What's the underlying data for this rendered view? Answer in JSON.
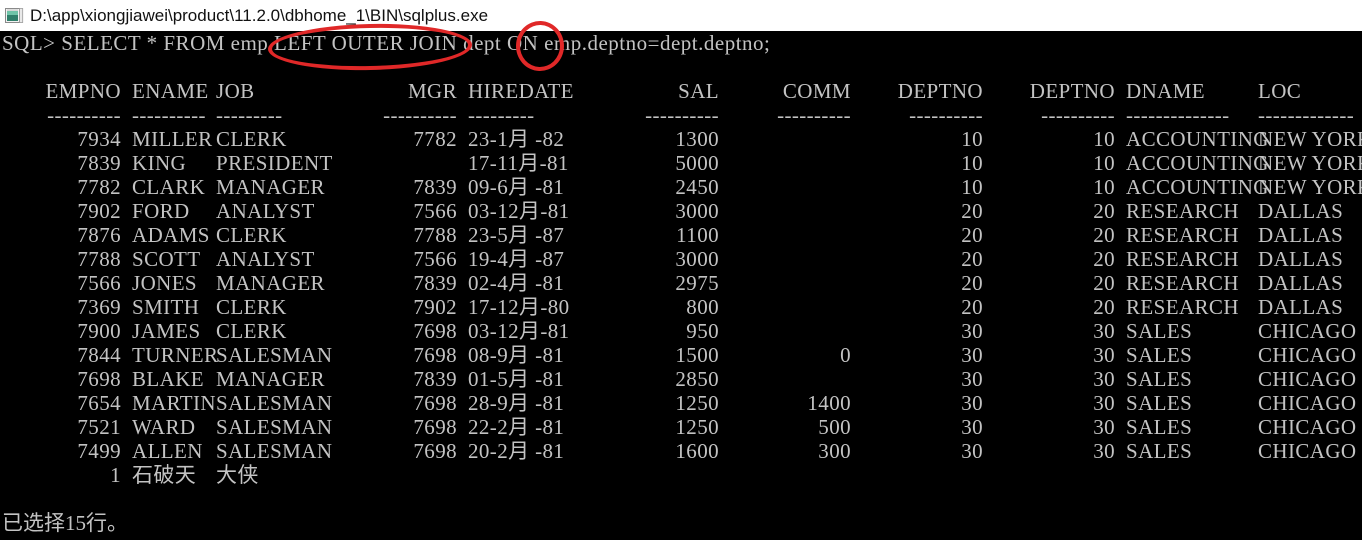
{
  "window": {
    "icon": "console-window-icon",
    "title": "D:\\app\\xiongjiawei\\product\\11.2.0\\dbhome_1\\BIN\\sqlplus.exe"
  },
  "console": {
    "prompt_line": "SQL> SELECT * FROM emp LEFT OUTER JOIN dept ON emp.deptno=dept.deptno;",
    "prompt": "SQL>",
    "statement": "SELECT * FROM emp LEFT OUTER JOIN dept ON emp.deptno=dept.deptno;",
    "status_line": "已选择15行。",
    "foreground_color": "#c3c3c3",
    "background_color": "#000000"
  },
  "annotations": [
    {
      "id": "ellipse-join",
      "target_text": "LEFT OUTER JOIN",
      "shape": "ellipse",
      "color": "#e02828"
    },
    {
      "id": "ellipse-on",
      "target_text": "ON",
      "shape": "ellipse",
      "color": "#e02828"
    }
  ],
  "table": {
    "headers": [
      "EMPNO",
      "ENAME",
      "JOB",
      "MGR",
      "HIREDATE",
      "SAL",
      "COMM",
      "DEPTNO",
      "DEPTNO",
      "DNAME",
      "LOC"
    ],
    "separators": [
      "----------",
      "----------",
      "---------",
      "----------",
      "---------",
      "----------",
      "----------",
      "----------",
      "----------",
      "--------------",
      "-------------"
    ],
    "rows": [
      [
        "7934",
        "MILLER",
        "CLERK",
        "7782",
        "23-1月 -82",
        "1300",
        "",
        "10",
        "10",
        "ACCOUNTING",
        "NEW YORK"
      ],
      [
        "7839",
        "KING",
        "PRESIDENT",
        "",
        "17-11月-81",
        "5000",
        "",
        "10",
        "10",
        "ACCOUNTING",
        "NEW YORK"
      ],
      [
        "7782",
        "CLARK",
        "MANAGER",
        "7839",
        "09-6月 -81",
        "2450",
        "",
        "10",
        "10",
        "ACCOUNTING",
        "NEW YORK"
      ],
      [
        "7902",
        "FORD",
        "ANALYST",
        "7566",
        "03-12月-81",
        "3000",
        "",
        "20",
        "20",
        "RESEARCH",
        "DALLAS"
      ],
      [
        "7876",
        "ADAMS",
        "CLERK",
        "7788",
        "23-5月 -87",
        "1100",
        "",
        "20",
        "20",
        "RESEARCH",
        "DALLAS"
      ],
      [
        "7788",
        "SCOTT",
        "ANALYST",
        "7566",
        "19-4月 -87",
        "3000",
        "",
        "20",
        "20",
        "RESEARCH",
        "DALLAS"
      ],
      [
        "7566",
        "JONES",
        "MANAGER",
        "7839",
        "02-4月 -81",
        "2975",
        "",
        "20",
        "20",
        "RESEARCH",
        "DALLAS"
      ],
      [
        "7369",
        "SMITH",
        "CLERK",
        "7902",
        "17-12月-80",
        "800",
        "",
        "20",
        "20",
        "RESEARCH",
        "DALLAS"
      ],
      [
        "7900",
        "JAMES",
        "CLERK",
        "7698",
        "03-12月-81",
        "950",
        "",
        "30",
        "30",
        "SALES",
        "CHICAGO"
      ],
      [
        "7844",
        "TURNER",
        "SALESMAN",
        "7698",
        "08-9月 -81",
        "1500",
        "0",
        "30",
        "30",
        "SALES",
        "CHICAGO"
      ],
      [
        "7698",
        "BLAKE",
        "MANAGER",
        "7839",
        "01-5月 -81",
        "2850",
        "",
        "30",
        "30",
        "SALES",
        "CHICAGO"
      ],
      [
        "7654",
        "MARTIN",
        "SALESMAN",
        "7698",
        "28-9月 -81",
        "1250",
        "1400",
        "30",
        "30",
        "SALES",
        "CHICAGO"
      ],
      [
        "7521",
        "WARD",
        "SALESMAN",
        "7698",
        "22-2月 -81",
        "1250",
        "500",
        "30",
        "30",
        "SALES",
        "CHICAGO"
      ],
      [
        "7499",
        "ALLEN",
        "SALESMAN",
        "7698",
        "20-2月 -81",
        "1600",
        "300",
        "30",
        "30",
        "SALES",
        "CHICAGO"
      ],
      [
        "1",
        "石破天",
        "大侠",
        "",
        "",
        "",
        "",
        "",
        "",
        "",
        ""
      ]
    ]
  }
}
